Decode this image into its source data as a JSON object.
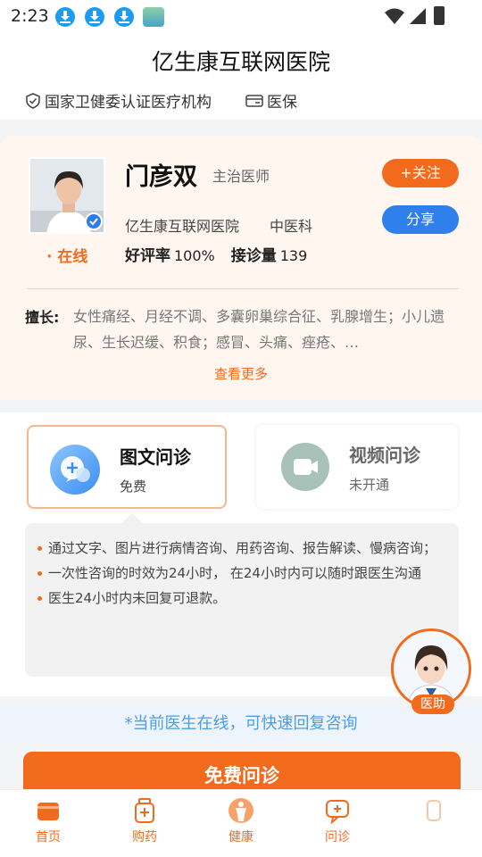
{
  "status_bar": {
    "time": "2:23"
  },
  "header": {
    "title": "亿生康互联网医院",
    "certification": "国家卫健委认证医疗机构",
    "insurance": "医保"
  },
  "doctor": {
    "name": "门彦双",
    "title": "主治医师",
    "online_status": "在线",
    "hospital": "亿生康互联网医院",
    "department": "中医科",
    "rating_label": "好评率",
    "rating_value": "100%",
    "consult_label": "接诊量",
    "consult_value": "139",
    "follow_label": "+关注",
    "share_label": "分享",
    "specialty_label": "擅长:",
    "specialty_text": "女性痛经、月经不调、多囊卵巢综合征、乳腺增生；小儿遗尿、生长迟缓、积食；感冒、头痛、痤疮、…",
    "more_label": "查看更多"
  },
  "consult_options": [
    {
      "title": "图文问诊",
      "subtitle": "免费"
    },
    {
      "title": "视频问诊",
      "subtitle": "未开通"
    }
  ],
  "description": [
    "通过文字、图片进行病情咨询、用药咨询、报告解读、慢病咨询；",
    "一次性咨询的时效为24小时， 在24小时内可以随时跟医生沟通",
    "医生24小时内未回复可退款。"
  ],
  "notice": "*当前医生在线，可快速回复咨询",
  "cta_label": "免费问诊",
  "assistant_label": "医助",
  "tabs": [
    {
      "label": "首页"
    },
    {
      "label": "购药"
    },
    {
      "label": "健康"
    },
    {
      "label": "问诊"
    }
  ],
  "colors": {
    "accent": "#f26b1d",
    "blue": "#2f80ed",
    "card_bg": "#fff6ef"
  }
}
